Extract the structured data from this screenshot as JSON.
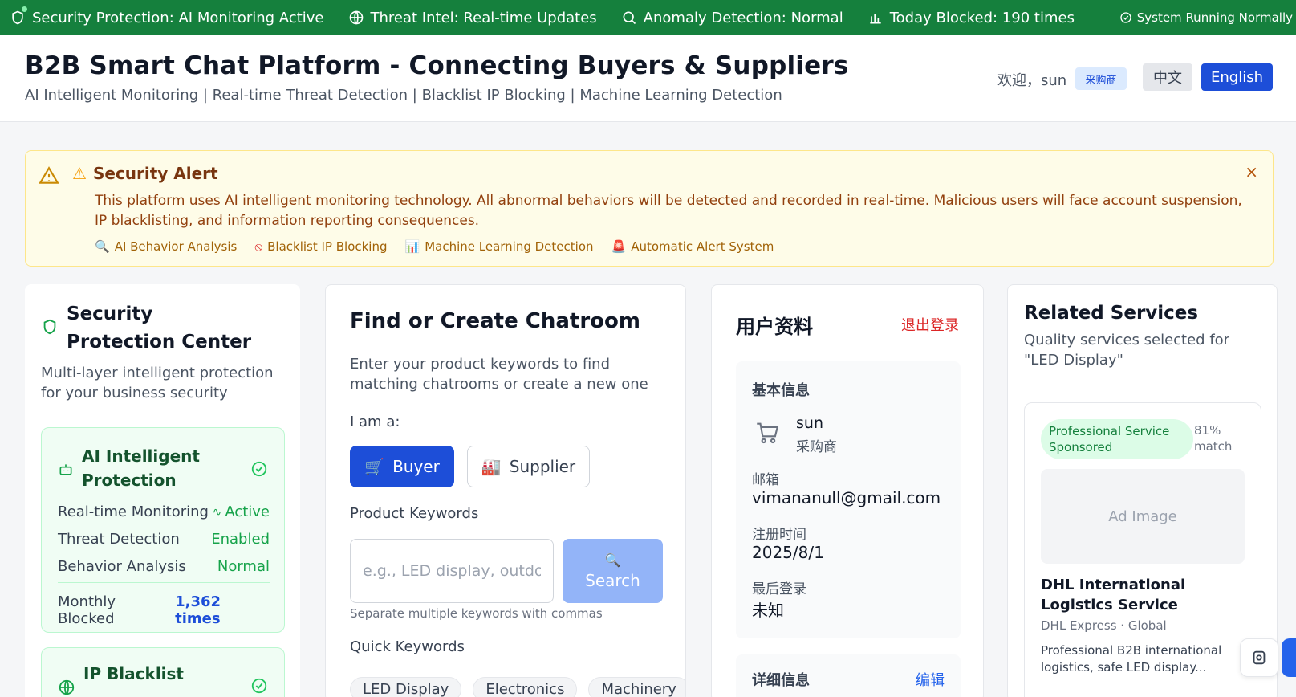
{
  "status_bar": {
    "items": [
      {
        "icon": "shield-icon",
        "label": "Security Protection: AI Monitoring Active"
      },
      {
        "icon": "globe-icon",
        "label": "Threat Intel: Real-time Updates"
      },
      {
        "icon": "search-icon",
        "label": "Anomaly Detection: Normal"
      },
      {
        "icon": "bar-chart-icon",
        "label": "Today Blocked: 190 times"
      }
    ],
    "system_status": "System Running Normally"
  },
  "header": {
    "title": "B2B Smart Chat Platform - Connecting Buyers & Suppliers",
    "subtitle": "AI Intelligent Monitoring | Real-time Threat Detection | Blacklist IP Blocking | Machine Learning Detection",
    "welcome": "欢迎，sun",
    "role_badge": "采购商",
    "lang_zh": "中文",
    "lang_en": "English"
  },
  "alert": {
    "title": "Security Alert",
    "body": "This platform uses AI intelligent monitoring technology. All abnormal behaviors will be detected and recorded in real-time. Malicious users will face account suspension, IP blacklisting, and information reporting consequences.",
    "features": [
      {
        "icon": "magnifier-icon",
        "label": "AI Behavior Analysis"
      },
      {
        "icon": "prohibited-icon",
        "label": "Blacklist IP Blocking"
      },
      {
        "icon": "chart-icon",
        "label": "Machine Learning Detection"
      },
      {
        "icon": "siren-icon",
        "label": "Automatic Alert System"
      }
    ],
    "close": "×"
  },
  "security_center": {
    "title": "Security Protection Center",
    "description": "Multi-layer intelligent protection for your business security",
    "ai_box": {
      "title": "AI Intelligent Protection",
      "rows": [
        {
          "label": "Real-time Monitoring",
          "value": "Active"
        },
        {
          "label": "Threat Detection",
          "value": "Enabled"
        },
        {
          "label": "Behavior Analysis",
          "value": "Normal"
        }
      ],
      "monthly_label": "Monthly Blocked",
      "monthly_value": "1,362 times"
    },
    "ip_box": {
      "title": "IP Blacklist"
    }
  },
  "chatroom": {
    "title": "Find or Create Chatroom",
    "description": "Enter your product keywords to find matching chatrooms or create a new one",
    "role_label": "I am a:",
    "buyer": "Buyer",
    "supplier": "Supplier",
    "keywords_label": "Product Keywords",
    "keywords_placeholder": "e.g., LED display, outdo",
    "search": "Search",
    "hint": "Separate multiple keywords with commas",
    "quick_label": "Quick Keywords",
    "quick_keywords": [
      "LED Display",
      "Electronics",
      "Machinery"
    ]
  },
  "profile": {
    "title": "用户资料",
    "logout": "退出登录",
    "basic_title": "基本信息",
    "username": "sun",
    "role": "采购商",
    "email_label": "邮箱",
    "email": "vimananull@gmail.com",
    "registered_label": "注册时间",
    "registered": "2025/8/1",
    "last_login_label": "最后登录",
    "last_login": "未知",
    "detail_title": "详细信息",
    "edit": "编辑"
  },
  "related": {
    "title": "Related Services",
    "subtitle": "Quality services selected for \"LED Display\"",
    "ad": {
      "badge": "Professional Service Sponsored",
      "match": "81% match",
      "image_placeholder": "Ad Image",
      "name": "DHL International Logistics Service",
      "provider": "DHL Express · Global",
      "description": "Professional B2B international logistics, safe LED display..."
    }
  }
}
